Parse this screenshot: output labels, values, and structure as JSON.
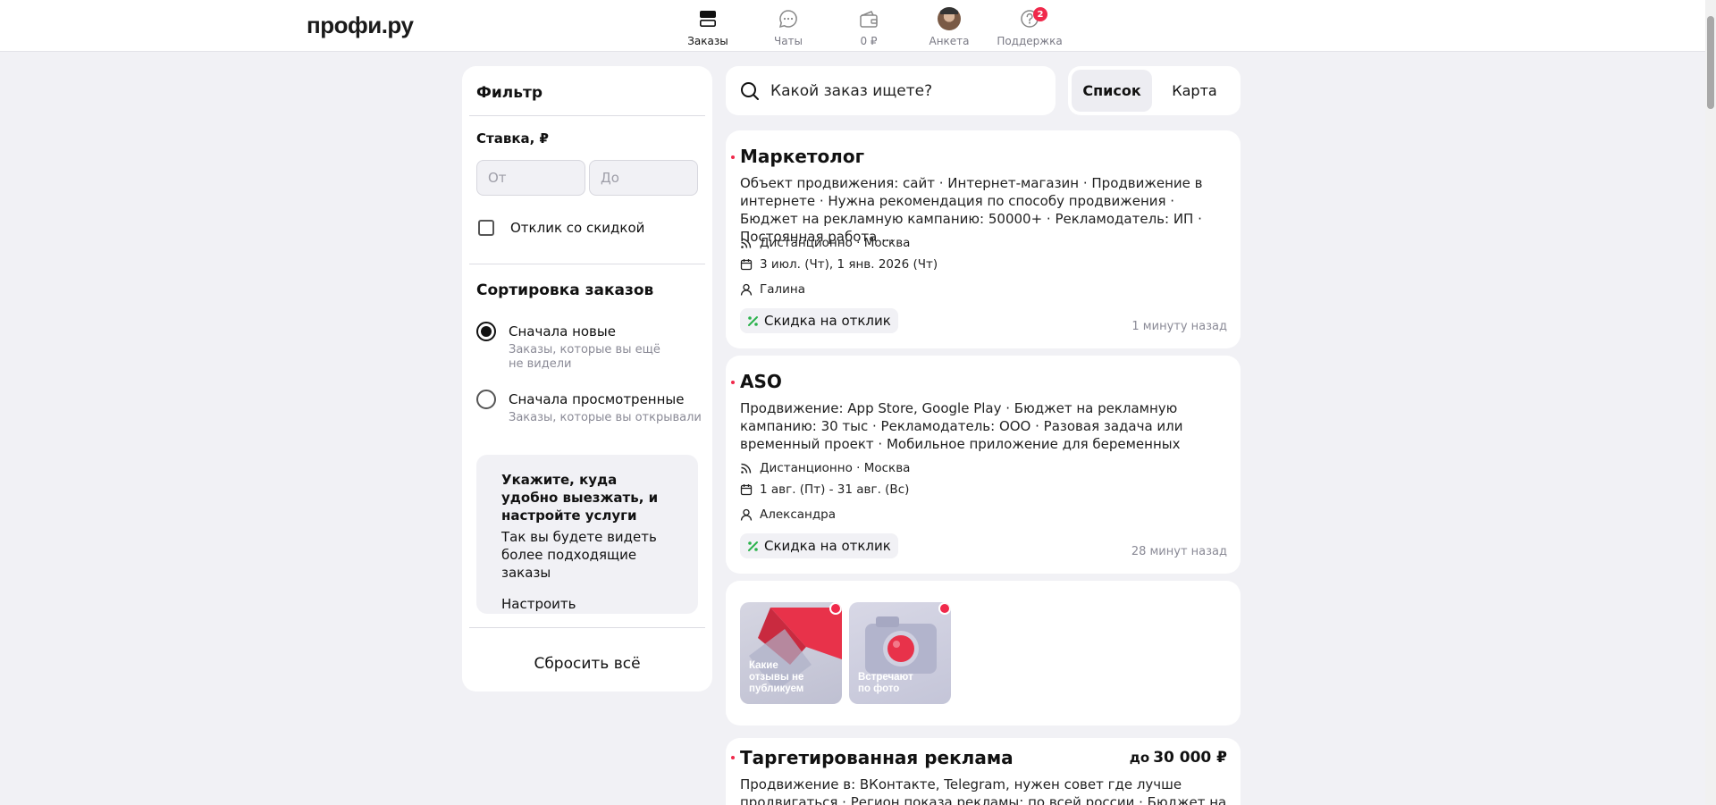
{
  "header": {
    "logo": "профи.ру",
    "nav": [
      {
        "label": "Заказы",
        "icon": "orders-icon"
      },
      {
        "label": "Чаты",
        "icon": "chat-icon"
      },
      {
        "label": "0 ₽",
        "icon": "wallet-icon"
      },
      {
        "label": "Анкета",
        "icon": "avatar"
      },
      {
        "label": "Поддержка",
        "icon": "help-icon",
        "badge": "2"
      }
    ]
  },
  "filter": {
    "title": "Фильтр",
    "rate_label": "Ставка, ₽",
    "from_placeholder": "От",
    "to_placeholder": "До",
    "discount_checkbox": "Отклик со скидкой",
    "sort_title": "Сортировка заказов",
    "sort_options": [
      {
        "label": "Сначала новые",
        "hint": "Заказы, которые вы ещё не видели",
        "selected": true
      },
      {
        "label": "Сначала просмотренные",
        "hint": "Заказы, которые вы открывали",
        "selected": false
      }
    ],
    "promo": {
      "title": "Укажите, куда удобно выезжать, и настройте услуги",
      "text": "Так вы будете видеть более подходящие заказы",
      "link": "Настроить"
    },
    "reset": "Сбросить всё"
  },
  "search": {
    "placeholder": "Какой заказ ищете?"
  },
  "view_toggle": {
    "list": "Список",
    "map": "Карта"
  },
  "orders": [
    {
      "title": "Маркетолог",
      "desc": "Объект продвижения: сайт · Интернет-магазин · Продвижение в интернете · Нужна рекомендация по способу продвижения · Бюджет на рекламную кампанию: 50000+ · Рекламодатель: ИП · Постоянная работа ...",
      "location": "Дистанционно · Москва",
      "dates": "3 июл. (Чт), 1 янв. 2026 (Чт)",
      "client": "Галина",
      "chip": "Скидка на отклик",
      "time": "1 минуту назад"
    },
    {
      "title": "ASO",
      "desc": "Продвижение: App Store, Google Play · Бюджет на рекламную кампанию: 30 тыс · Рекламодатель: ООО · Разовая задача или временный проект · Мобильное приложение для беременных",
      "location": "Дистанционно · Москва",
      "dates": "1 авг. (Пт) - 31 авг. (Вс)",
      "client": "Александра",
      "chip": "Скидка на отклик",
      "time": "28 минут назад"
    },
    {
      "title": "Таргетированная реклама",
      "price_prefix": "до",
      "price": "30 000 ₽",
      "desc": "Продвижение в: ВКонтакте, Telegram, нужен совет где лучше продвигаться · Регион показа рекламы: по всей россии · Бюджет на"
    }
  ],
  "stories": [
    {
      "text": "Какие отзывы не публикуем"
    },
    {
      "text": "Встречают по фото"
    }
  ],
  "colors": {
    "accent": "#f0294b",
    "discount_icon": "#2bb24c"
  }
}
